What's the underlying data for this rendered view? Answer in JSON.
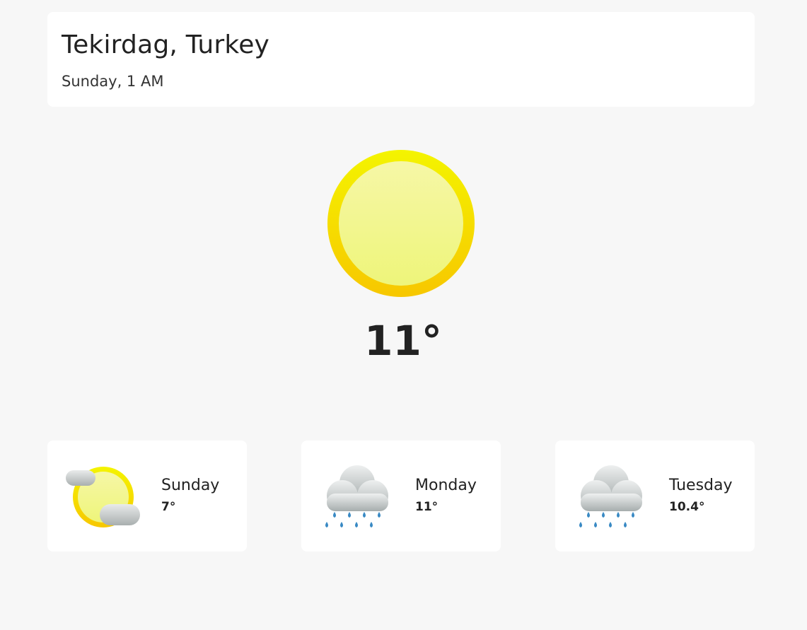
{
  "location": "Tekirdag, Turkey",
  "datetime": "Sunday, 1 AM",
  "current": {
    "icon": "sun-icon",
    "temperature": "11°"
  },
  "forecast": [
    {
      "day": "Sunday",
      "temp": "7°",
      "icon": "partly-cloudy-icon"
    },
    {
      "day": "Monday",
      "temp": "11°",
      "icon": "rain-cloud-icon"
    },
    {
      "day": "Tuesday",
      "temp": "10.4°",
      "icon": "rain-cloud-icon"
    }
  ],
  "colors": {
    "background": "#f7f7f7",
    "card": "#ffffff",
    "sun_outer": "#f7e200",
    "sun_inner": "#f2f394",
    "cloud": "#c9cdcd",
    "rain": "#3a8ac4"
  }
}
